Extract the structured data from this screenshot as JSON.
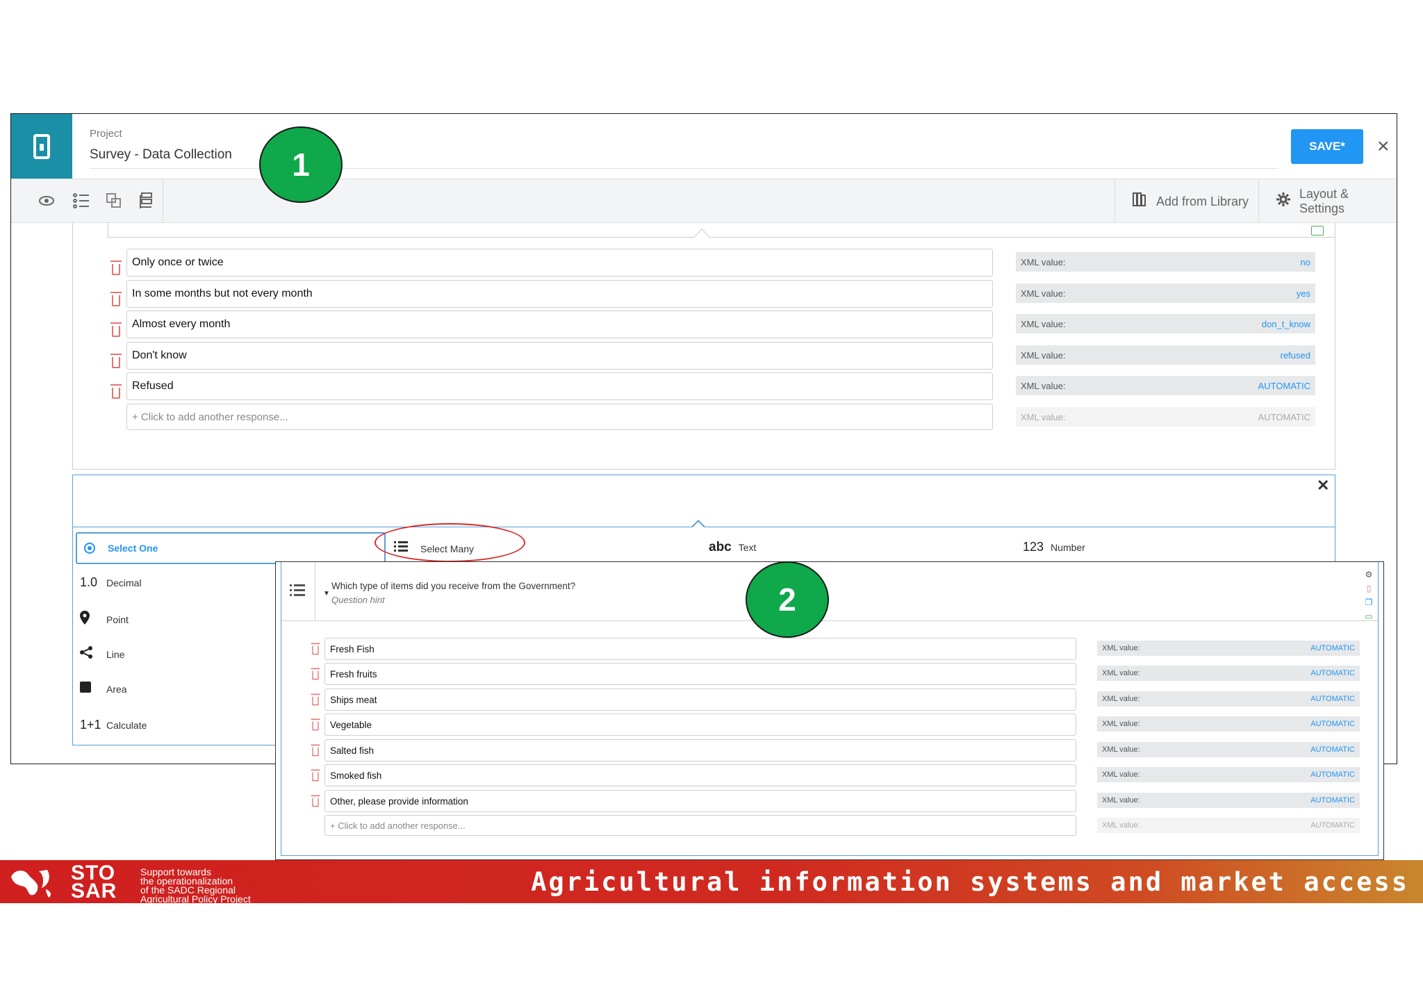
{
  "header": {
    "project_label": "Project",
    "project_name": "Survey - Data Collection",
    "save_label": "SAVE*",
    "close_glyph": "×"
  },
  "toolbar": {
    "add_from_library": "Add from Library",
    "layout_settings": "Layout & Settings",
    "icons": [
      "eye-icon",
      "list-icon",
      "copy-icon",
      "tree-icon"
    ]
  },
  "card1": {
    "responses": [
      {
        "label": "Only once or twice",
        "xml_label": "XML value:",
        "xml_value": "no"
      },
      {
        "label": "In some months but not every month",
        "xml_label": "XML value:",
        "xml_value": "yes"
      },
      {
        "label": "Almost every  month",
        "xml_label": "XML value:",
        "xml_value": "don_t_know"
      },
      {
        "label": "Don't know",
        "xml_label": "XML value:",
        "xml_value": "refused"
      },
      {
        "label": "Refused",
        "xml_label": "XML value:",
        "xml_value": "AUTOMATIC"
      }
    ],
    "add_placeholder": "+ Click to add another response...",
    "add_xml_label": "XML value:",
    "add_xml_value": "AUTOMATIC"
  },
  "types": {
    "select_one": "Select One",
    "select_many": "Select Many",
    "text_icon": "abc",
    "text": "Text",
    "number_icon": "123",
    "number": "Number",
    "decimal_icon": "1.0",
    "decimal": "Decimal",
    "point": "Point",
    "line": "Line",
    "area": "Area",
    "calculate_icon": "1+1",
    "calculate": "Calculate"
  },
  "panel2": {
    "question": "Which type of items did you receive from the Government?",
    "hint": "Question hint",
    "responses": [
      {
        "label": "Fresh Fish",
        "xml_label": "XML value:",
        "xml_value": "AUTOMATIC"
      },
      {
        "label": "Fresh fruits",
        "xml_label": "XML value:",
        "xml_value": "AUTOMATIC"
      },
      {
        "label": "Ships meat",
        "xml_label": "XML value:",
        "xml_value": "AUTOMATIC"
      },
      {
        "label": "Vegetable",
        "xml_label": "XML value:",
        "xml_value": "AUTOMATIC"
      },
      {
        "label": "Salted fish",
        "xml_label": "XML value:",
        "xml_value": "AUTOMATIC"
      },
      {
        "label": "Smoked fish",
        "xml_label": "XML value:",
        "xml_value": "AUTOMATIC"
      },
      {
        "label": "Other, please provide information",
        "xml_label": "XML value:",
        "xml_value": "AUTOMATIC"
      }
    ],
    "add_placeholder": "+ Click to add another response...",
    "add_xml_label": "XML value:",
    "add_xml_value": "AUTOMATIC"
  },
  "badges": {
    "one": "1",
    "two": "2"
  },
  "footer": {
    "logo_line1": "STO",
    "logo_line2": "SAR",
    "sub1": "Support towards",
    "sub2": "the operationalization",
    "sub3": "of the SADC Regional",
    "sub4": "Agricultural Policy Project",
    "tagline": "Agricultural information systems and market access"
  },
  "colors": {
    "accent": "#2196f3",
    "brand_teal": "#1a8fa6",
    "badge_green": "#0fa84a",
    "callout_red": "#d62b2b",
    "footer_red": "#cf1f1f"
  }
}
